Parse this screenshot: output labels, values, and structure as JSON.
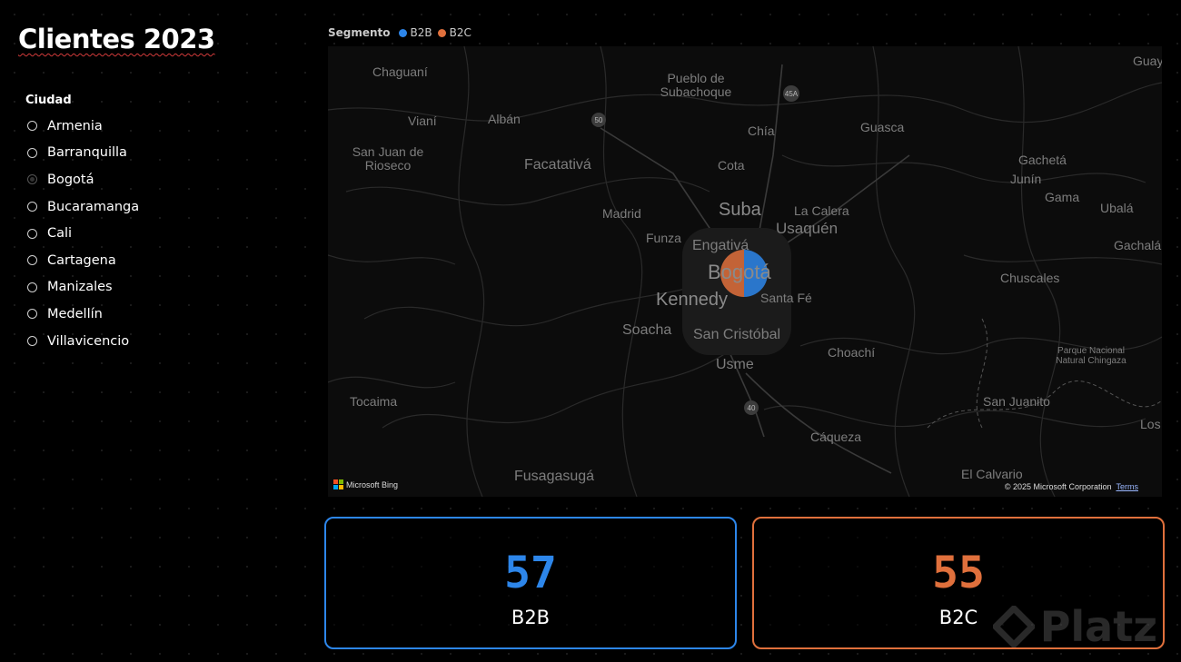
{
  "title": {
    "text": "Clientes 2023"
  },
  "slicer": {
    "header": "Ciudad",
    "selected_index": 2,
    "items": [
      "Armenia",
      "Barranquilla",
      "Bogotá",
      "Bucaramanga",
      "Cali",
      "Cartagena",
      "Manizales",
      "Medellín",
      "Villavicencio"
    ]
  },
  "legend": {
    "title": "Segmento",
    "items": [
      {
        "label": "B2B",
        "color": "#2d86ea"
      },
      {
        "label": "B2C",
        "color": "#e0703c"
      }
    ]
  },
  "map": {
    "places": [
      "Chaguaní",
      "Pueblo de Subachoque",
      "Guayat",
      "Vianí",
      "Albán",
      "Chía",
      "Guasca",
      "San Juan de Rioseco",
      "Facatativá",
      "Cota",
      "Gachetá",
      "Junín",
      "Gama",
      "Madrid",
      "Suba",
      "La Calera",
      "Ubalá",
      "Funza",
      "Engativá",
      "Usaquén",
      "Gachalá",
      "Bogotá",
      "Chuscales",
      "Kennedy",
      "Santa Fé",
      "Soacha",
      "San Cristóbal",
      "Choachí",
      "Parque Nacional Natural Chingaza",
      "Usme",
      "Tocaima",
      "San Juanito",
      "Los",
      "Cáqueza",
      "Fusagasugá",
      "El Calvario"
    ],
    "road_shields": [
      "50",
      "45A",
      "40"
    ],
    "bubble": {
      "b2b_share": 0.5,
      "b2c_share": 0.5
    },
    "attribution": "Microsoft Bing",
    "copyright": "© 2025 Microsoft Corporation",
    "terms": "Terms"
  },
  "cards": [
    {
      "value": "57",
      "label": "B2B",
      "color": "#2d86ea"
    },
    {
      "value": "55",
      "label": "B2C",
      "color": "#e0703c"
    }
  ],
  "watermark": {
    "text": "Platz",
    "icon": "platzi-logo-icon"
  }
}
